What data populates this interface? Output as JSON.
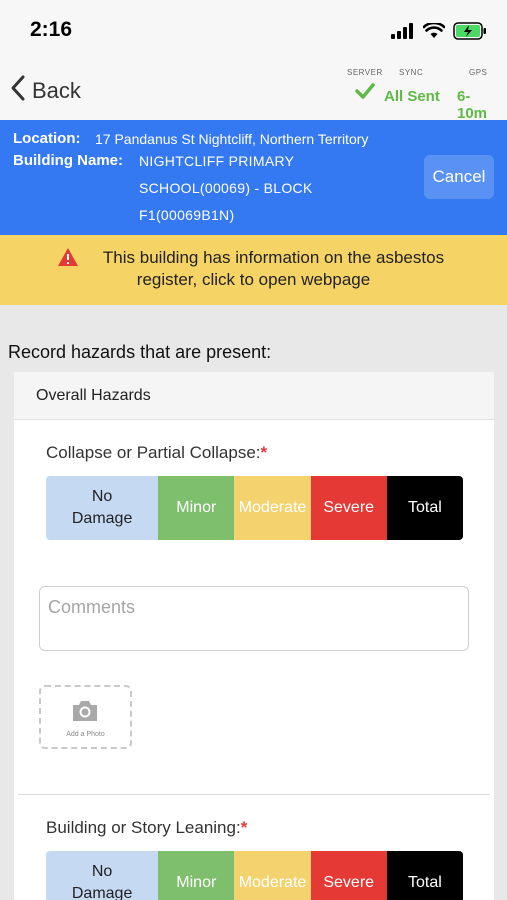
{
  "status_bar": {
    "time": "2:16"
  },
  "nav": {
    "back_label": "Back",
    "server_caption": "SERVER",
    "sync_caption": "SYNC",
    "gps_caption": "GPS",
    "sync_status": "All Sent",
    "gps_value": "6-10m"
  },
  "info": {
    "location_label": "Location:",
    "location_value": "17 Pandanus St Nightcliff, Northern Territory",
    "building_label": "Building Name:",
    "building_lines": [
      "NIGHTCLIFF PRIMARY",
      "SCHOOL(00069) - BLOCK",
      "F1(00069B1N)"
    ],
    "cancel_label": "Cancel"
  },
  "warning": {
    "lines": [
      "This building has information on the asbestos",
      "register, click to open webpage"
    ]
  },
  "form": {
    "record_label": "Record hazards that are present:",
    "section_title": "Overall Hazards",
    "questions": [
      {
        "label": "Collapse or Partial Collapse:",
        "required_mark": "*"
      },
      {
        "label": "Building or Story Leaning:",
        "required_mark": "*"
      }
    ],
    "damage_options": [
      "No Damage",
      "Minor",
      "Moderate",
      "Severe",
      "Total"
    ],
    "comments_placeholder": "Comments",
    "add_photo_label": "Add a Photo"
  },
  "colors": {
    "header_blue": "#3479f2",
    "warning_yellow": "#f6d365",
    "sync_green": "#5fb946",
    "no_damage": "#c5d9f3",
    "minor": "#7ebf6e",
    "moderate": "#f4d36e",
    "severe": "#e53935",
    "total": "#000000"
  }
}
